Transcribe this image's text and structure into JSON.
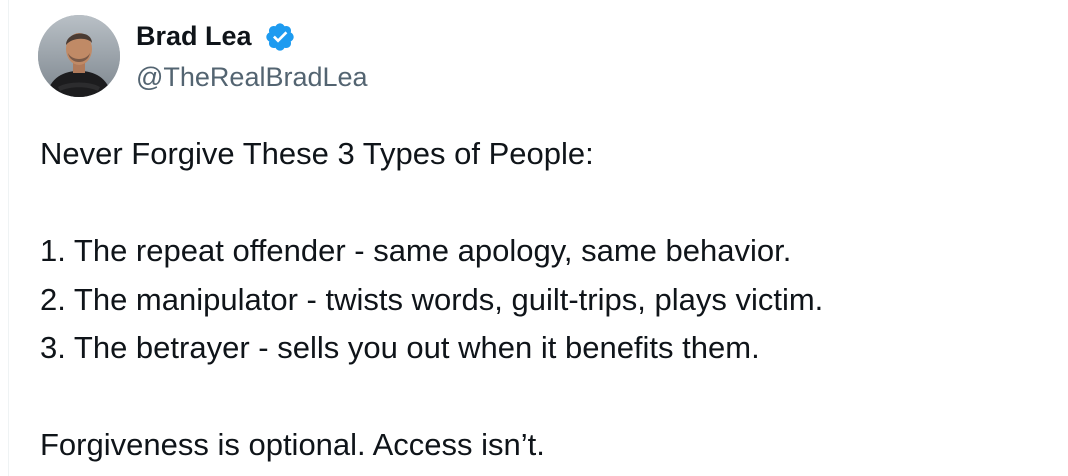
{
  "author": {
    "name": "Brad Lea",
    "handle": "@TheRealBradLea",
    "verified": true,
    "avatar_icon": "profile-photo",
    "verified_icon": "verified-badge-icon",
    "verified_color": "#1d9bf0"
  },
  "tweet": {
    "lines": [
      "Never Forgive These 3 Types of People:",
      "",
      "1. The repeat offender - same apology, same behavior.",
      "2. The manipulator - twists words, guilt-trips, plays victim.",
      "3. The betrayer - sells you out when it benefits them.",
      "",
      "Forgiveness is optional. Access isn’t."
    ]
  },
  "colors": {
    "text": "#0f1419",
    "secondary_text": "#536471",
    "background": "#ffffff"
  }
}
